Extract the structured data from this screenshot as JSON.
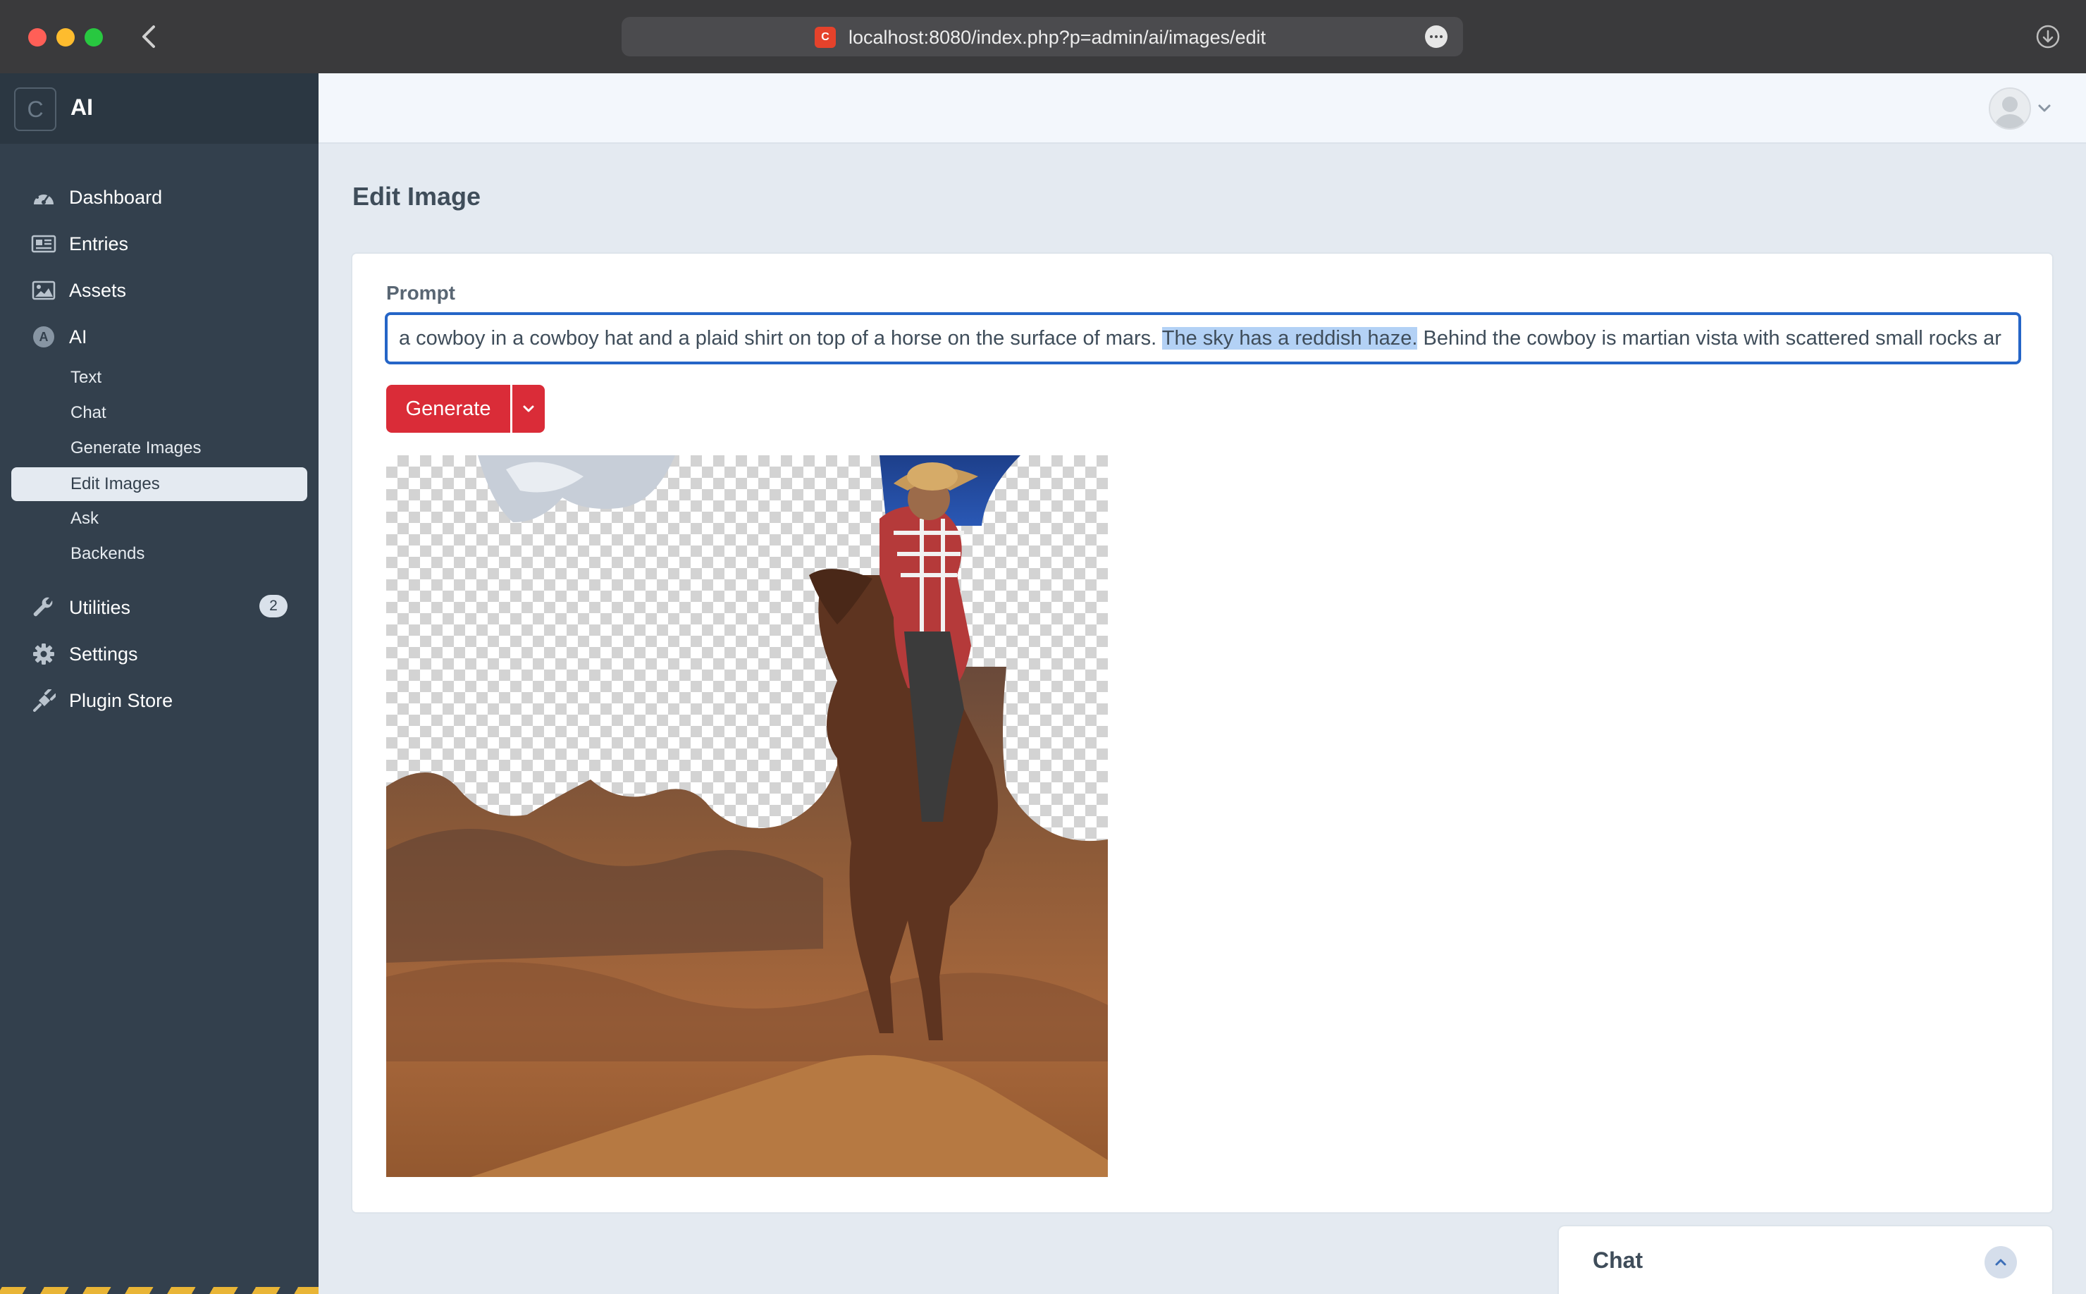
{
  "browser": {
    "url": "localhost:8080/index.php?p=admin/ai/images/edit",
    "favicon_letter": "C"
  },
  "sidebar": {
    "logo_letter": "C",
    "site_name": "AI",
    "nav": [
      {
        "label": "Dashboard",
        "icon": "dashboard-icon"
      },
      {
        "label": "Entries",
        "icon": "entries-icon"
      },
      {
        "label": "Assets",
        "icon": "assets-icon"
      },
      {
        "label": "AI",
        "icon": "ai-icon",
        "icon_letter": "A"
      },
      {
        "label": "Utilities",
        "icon": "wrench-icon",
        "badge": "2"
      },
      {
        "label": "Settings",
        "icon": "gear-icon"
      },
      {
        "label": "Plugin Store",
        "icon": "plug-icon"
      }
    ],
    "ai_subnav": [
      "Text",
      "Chat",
      "Generate Images",
      "Edit Images",
      "Ask",
      "Backends"
    ],
    "active_subnav": "Edit Images"
  },
  "main": {
    "title": "Edit Image",
    "prompt": {
      "label": "Prompt",
      "value_before": "a cowboy in a cowboy hat and a plaid shirt on top of a horse on the surface of mars. ",
      "value_selected": "The sky has a reddish haze.",
      "value_after": " Behind the cowboy is martian vista with scattered small rocks ar"
    },
    "generate_button": "Generate"
  },
  "chat_panel": {
    "title": "Chat"
  },
  "colors": {
    "sidebar_bg": "#33404d",
    "accent_red": "#da2c38",
    "focus_blue": "#2565c7",
    "page_bg": "#e4eaf1"
  }
}
